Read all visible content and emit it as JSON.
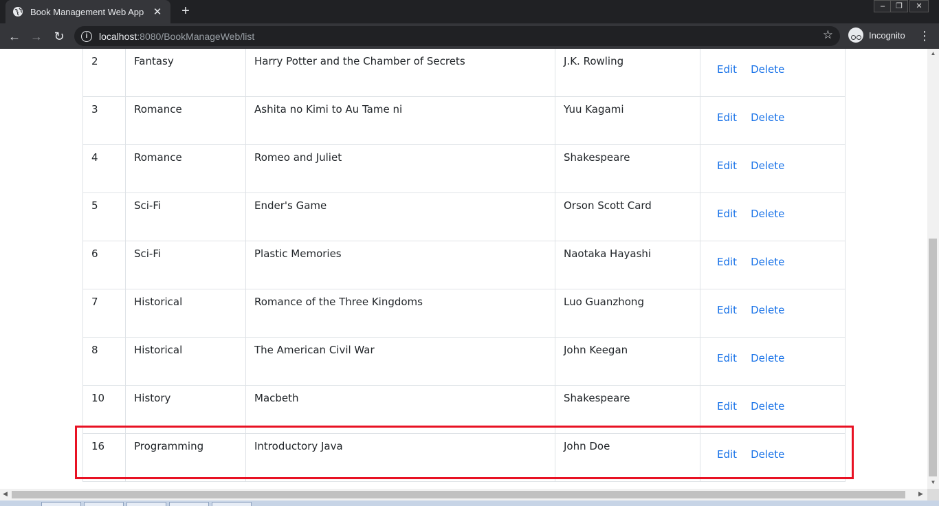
{
  "browser": {
    "tab_title": "Book Management Web App",
    "url_host": "localhost",
    "url_rest": ":8080/BookManageWeb/list",
    "profile_label": "Incognito"
  },
  "table": {
    "rows": [
      {
        "id": "2",
        "category": "Fantasy",
        "title": "Harry Potter and the Chamber of Secrets",
        "author": "J.K. Rowling"
      },
      {
        "id": "3",
        "category": "Romance",
        "title": "Ashita no Kimi to Au Tame ni",
        "author": "Yuu Kagami"
      },
      {
        "id": "4",
        "category": "Romance",
        "title": "Romeo and Juliet",
        "author": "Shakespeare"
      },
      {
        "id": "5",
        "category": "Sci-Fi",
        "title": "Ender's Game",
        "author": "Orson Scott Card"
      },
      {
        "id": "6",
        "category": "Sci-Fi",
        "title": "Plastic Memories",
        "author": "Naotaka Hayashi"
      },
      {
        "id": "7",
        "category": "Historical",
        "title": "Romance of the Three Kingdoms",
        "author": "Luo Guanzhong"
      },
      {
        "id": "8",
        "category": "Historical",
        "title": "The American Civil War",
        "author": "John Keegan"
      },
      {
        "id": "10",
        "category": "History",
        "title": "Macbeth",
        "author": "Shakespeare"
      },
      {
        "id": "16",
        "category": "Programming",
        "title": "Introductory Java",
        "author": "John Doe"
      }
    ],
    "edit_label": "Edit",
    "delete_label": "Delete"
  },
  "colors": {
    "link": "#1a73e8",
    "highlight": "#e81123"
  }
}
